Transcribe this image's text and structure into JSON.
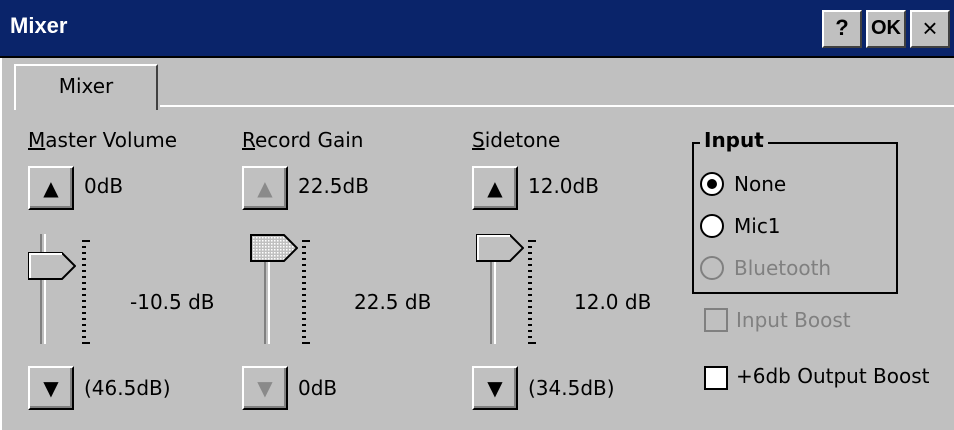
{
  "window": {
    "title": "Mixer",
    "help_label": "?",
    "ok_label": "OK",
    "close_label": "×",
    "title_color": "#0a246a"
  },
  "tabs": [
    {
      "label": "Mixer",
      "selected": true
    }
  ],
  "master_volume": {
    "label_ul": "M",
    "label_rest": "aster Volume",
    "top_value": "0dB",
    "current": "-10.5 dB",
    "bottom_value": "(46.5dB)",
    "level": 0.82
  },
  "record_gain": {
    "label_ul": "R",
    "label_rest": "ecord Gain",
    "top_value": "22.5dB",
    "current": "22.5 dB",
    "bottom_value": "0dB",
    "level": 1.0
  },
  "sidetone": {
    "label_ul": "S",
    "label_rest": "idetone",
    "top_value": "12.0dB",
    "current": "12.0 dB",
    "bottom_value": "(34.5dB)",
    "level": 1.0
  },
  "input_group": {
    "title": "Input",
    "options": [
      {
        "label": "None",
        "checked": true,
        "enabled": true
      },
      {
        "label": "Mic1",
        "checked": false,
        "enabled": true
      },
      {
        "label": "Bluetooth",
        "checked": false,
        "enabled": false
      }
    ]
  },
  "input_boost": {
    "label": "Input Boost",
    "checked": false,
    "enabled": false
  },
  "output_boost": {
    "label": "+6db Output Boost",
    "checked": false,
    "enabled": true
  }
}
